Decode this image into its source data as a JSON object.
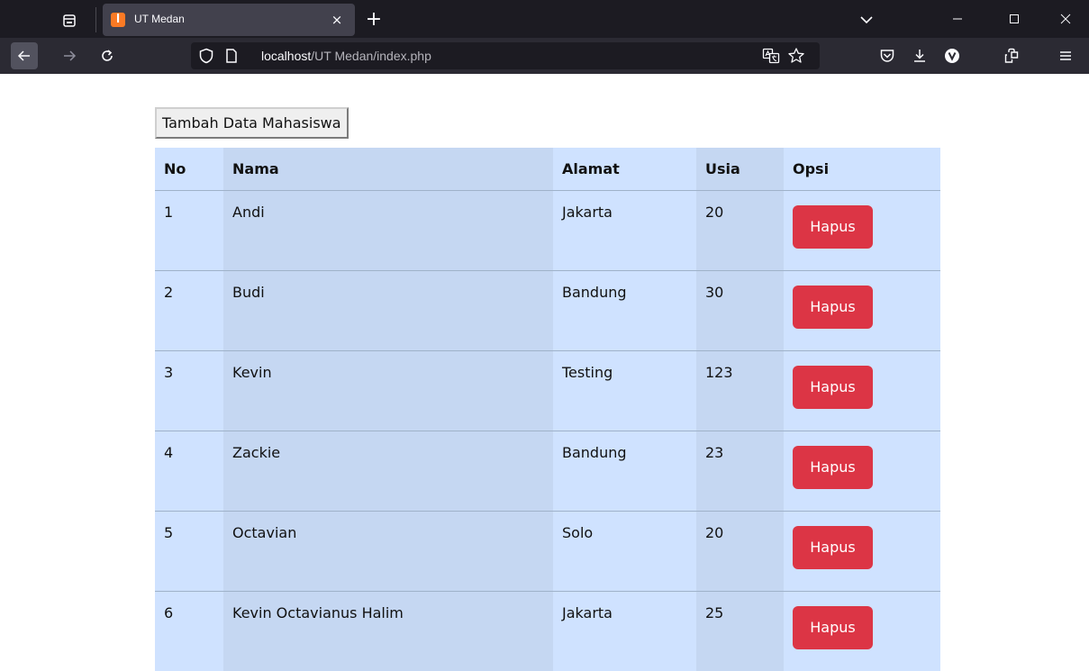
{
  "browser": {
    "tab": {
      "title": "UT Medan",
      "favicon": "xampp-icon",
      "favicon_glyph": "ꟾ"
    },
    "new_tab_glyph": "+",
    "close_tab_glyph": "×",
    "url": {
      "host": "localhost",
      "path": "/UT Medan/index.php"
    }
  },
  "page": {
    "add_button_label": "Tambah Data Mahasiswa",
    "table": {
      "headers": {
        "no": "No",
        "nama": "Nama",
        "alamat": "Alamat",
        "usia": "Usia",
        "opsi": "Opsi"
      },
      "rows": [
        {
          "no": "1",
          "nama": "Andi",
          "alamat": "Jakarta",
          "usia": "20",
          "action": "Hapus"
        },
        {
          "no": "2",
          "nama": "Budi",
          "alamat": "Bandung",
          "usia": "30",
          "action": "Hapus"
        },
        {
          "no": "3",
          "nama": "Kevin",
          "alamat": "Testing",
          "usia": "123",
          "action": "Hapus"
        },
        {
          "no": "4",
          "nama": "Zackie",
          "alamat": "Bandung",
          "usia": "23",
          "action": "Hapus"
        },
        {
          "no": "5",
          "nama": "Octavian",
          "alamat": "Solo",
          "usia": "20",
          "action": "Hapus"
        },
        {
          "no": "6",
          "nama": "Kevin Octavianus Halim",
          "alamat": "Jakarta",
          "usia": "25",
          "action": "Hapus"
        }
      ]
    }
  },
  "colors": {
    "tab_strip": "#1c1b22",
    "toolbar": "#2b2a33",
    "table_light": "#cfe2ff",
    "table_dark": "#c5d7f2",
    "delete_button": "#dc3545"
  }
}
